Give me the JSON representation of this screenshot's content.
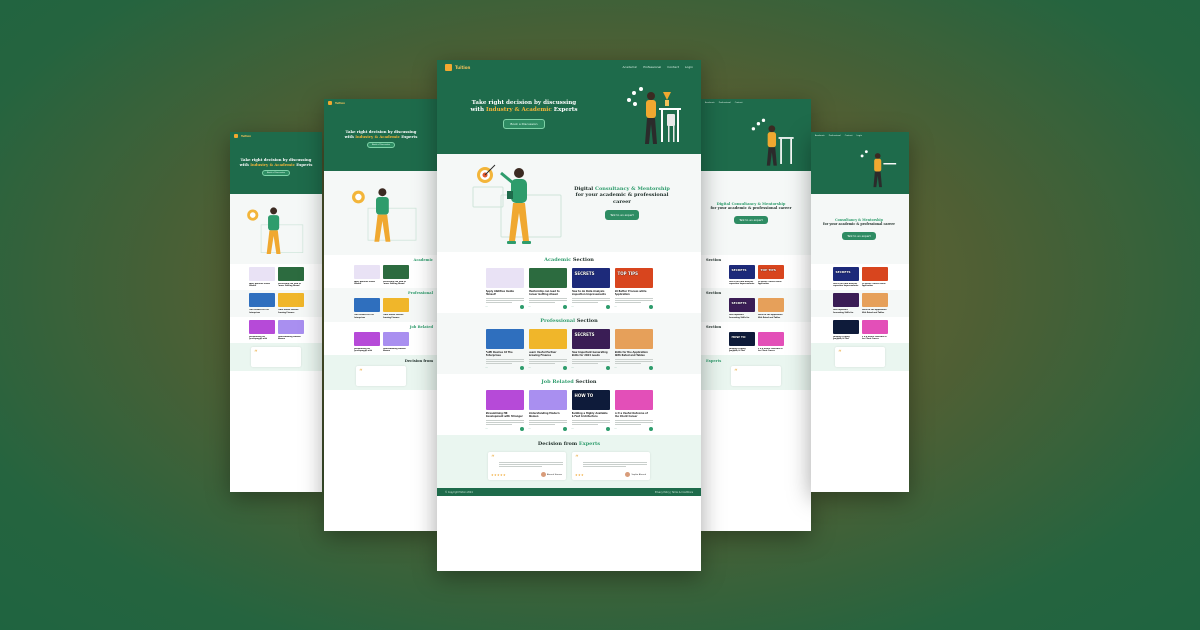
{
  "site": {
    "brand": "Tuition",
    "nav_links": [
      "Academic",
      "Professional",
      "Contact",
      "Login"
    ],
    "hero": {
      "title_part1": "Take right decision by discussing",
      "title_part2": "with ",
      "title_accent": "Industry & Academic",
      "title_part3": " Experts",
      "cta": "Book a Discussion"
    },
    "intro": {
      "title_accent": "Digital",
      "title_accent2": "Consultancy & Mentorship",
      "title_part": "for your academic & professional career",
      "cta": "Talk to an expert"
    },
    "sections": [
      {
        "title": "Academic",
        "suffix": " Section",
        "cards": [
          {
            "title": "Apply Abilities Inside Himself",
            "thumb": "",
            "color": "#e9e2f5"
          },
          {
            "title": "Mentorship can lead to Career Getting Ahead",
            "thumb": "",
            "color": "#2c6b3f"
          },
          {
            "title": "How to do Data Analysis Inspection Improvements",
            "thumb": "SECRETS",
            "color": "#1d2a7a"
          },
          {
            "title": "10 Better Process while Application",
            "thumb": "TOP TIPS",
            "color": "#d8451e"
          }
        ]
      },
      {
        "title": "Professional",
        "suffix": " Section",
        "cards": [
          {
            "title": "Fulfil Desires At The Enterprises",
            "thumb": "",
            "color": "#2f6fbe"
          },
          {
            "title": "Learn Useful Partner Growing Finance",
            "thumb": "",
            "color": "#f0b62a"
          },
          {
            "title": "How Important Generating Skills for 2024 needs",
            "thumb": "SECRETS",
            "color": "#3a1d55"
          },
          {
            "title": "Skills for the Application With Rated and Tables",
            "thumb": "",
            "color": "#e6a05a"
          }
        ]
      },
      {
        "title": "Job Related",
        "suffix": " Section",
        "cards": [
          {
            "title": "Streamlining HR Development with Stronger Values",
            "thumb": "",
            "color": "#b64ad8"
          },
          {
            "title": "Understanding Modern Women",
            "thumb": "",
            "color": "#a98ff0"
          },
          {
            "title": "Building a Highly Available & Fast Architecture",
            "thumb": "HOW TO",
            "color": "#0e1b3a"
          },
          {
            "title": "Is it a Useful Outcome of the Client Career",
            "thumb": "",
            "color": "#e34fb8"
          }
        ]
      }
    ],
    "decision": {
      "title": "Decision from",
      "title_accent": " Experts",
      "testimonials": [
        {
          "stars": "★★★★★",
          "name": "Ahmed Hassan"
        },
        {
          "stars": "★★★",
          "name": "Sophia Ahmed"
        }
      ]
    },
    "footer": {
      "left": "© Copyright Tuition 2024",
      "right": "Privacy Policy | Terms & Conditions"
    }
  },
  "colors": {
    "primary": "#1e6b4b",
    "accent": "#2e9c6c",
    "highlight": "#f3b53a"
  }
}
